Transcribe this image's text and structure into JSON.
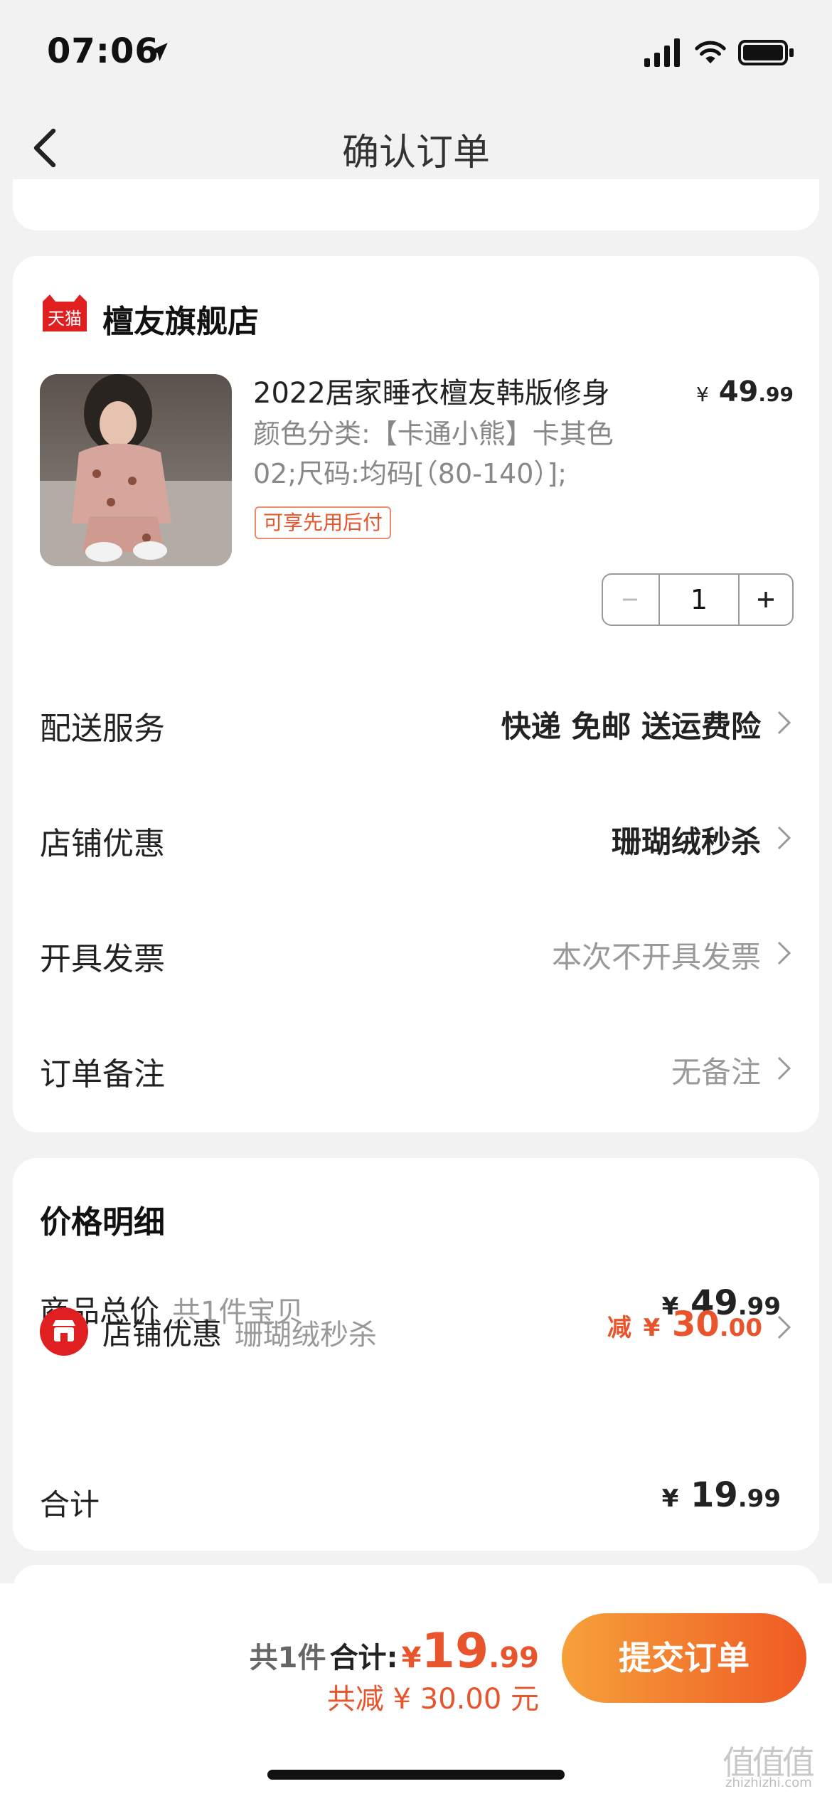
{
  "status_bar": {
    "time": "07:06"
  },
  "nav": {
    "title": "确认订单"
  },
  "store": {
    "badge": "天猫",
    "name": "檀友旗舰店"
  },
  "product": {
    "title": "2022居家睡衣檀友韩版修身",
    "price_symbol": "¥",
    "price_int": "49",
    "price_dec": ".99",
    "spec_line1": "颜色分类:【卡通小熊】卡其色",
    "spec_line2": "02;尺码:均码[（80-140）];",
    "tag": "可享先用后付",
    "quantity": "1"
  },
  "options": [
    {
      "label": "配送服务",
      "value": "快递 免邮 送运费险"
    },
    {
      "label": "店铺优惠",
      "value": "珊瑚绒秒杀"
    },
    {
      "label": "开具发票",
      "value": "本次不开具发票"
    },
    {
      "label": "订单备注",
      "value": "无备注"
    }
  ],
  "price_detail": {
    "title": "价格明细",
    "goods_label": "商品总价",
    "goods_sub": "共1件宝贝",
    "goods_symbol": "¥",
    "goods_int": "49",
    "goods_dec": ".99",
    "discount_label": "店铺优惠",
    "discount_sub": "珊瑚绒秒杀",
    "discount_prefix": "减",
    "discount_symbol": "¥",
    "discount_int": "30",
    "discount_dec": ".00",
    "total_label": "合计",
    "total_symbol": "¥",
    "total_int": "19",
    "total_dec": ".99"
  },
  "bottom_bar": {
    "count": "共1件",
    "total_label": "合计:",
    "symbol": "¥",
    "total_int": "19",
    "total_dec": ".99",
    "saved": "共减 ¥ 30.00 元",
    "submit": "提交订单"
  },
  "watermark": {
    "glyphs": "值值值",
    "text": "zhizhizhi.com"
  },
  "colors": {
    "accent": "#e8542c",
    "button_start": "#f6a13a",
    "button_end": "#ef5a24",
    "tmall_red": "#e02020"
  }
}
